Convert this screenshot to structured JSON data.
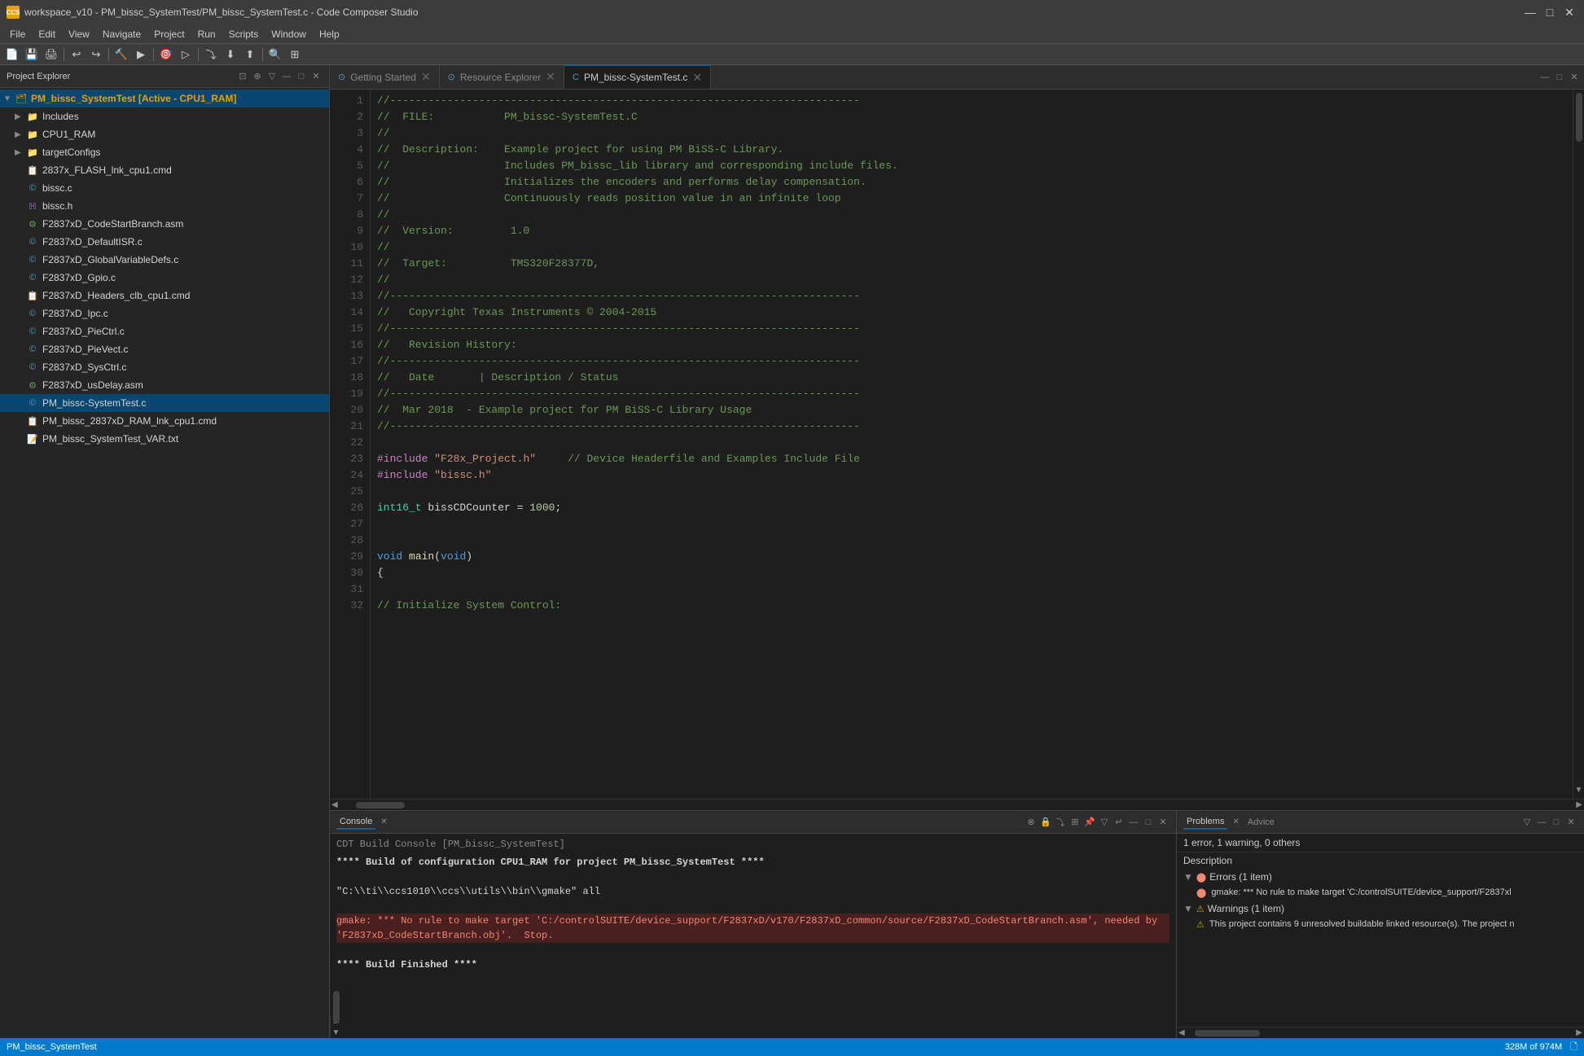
{
  "app": {
    "title": "workspace_v10 - PM_bissc_SystemTest/PM_bissc_SystemTest.c - Code Composer Studio",
    "icon_text": "CCS"
  },
  "window_controls": {
    "minimize": "—",
    "maximize": "□",
    "close": "✕"
  },
  "menu": {
    "items": [
      "File",
      "Edit",
      "View",
      "Navigate",
      "Project",
      "Run",
      "Scripts",
      "Window",
      "Help"
    ]
  },
  "project_explorer": {
    "title": "Project Explorer",
    "root": {
      "name": "PM_bissc_SystemTest  [Active - CPU1_RAM]",
      "children": [
        {
          "name": "Includes",
          "type": "folder",
          "indent": 1
        },
        {
          "name": "CPU1_RAM",
          "type": "folder",
          "indent": 1
        },
        {
          "name": "targetConfigs",
          "type": "folder",
          "indent": 1
        },
        {
          "name": "2837x_FLASH_lnk_cpu1.cmd",
          "type": "cmd",
          "indent": 1
        },
        {
          "name": "bissc.c",
          "type": "c",
          "indent": 1
        },
        {
          "name": "bissc.h",
          "type": "h",
          "indent": 1
        },
        {
          "name": "F2837xD_CodeStartBranch.asm",
          "type": "asm",
          "indent": 1
        },
        {
          "name": "F2837xD_DefaultISR.c",
          "type": "c",
          "indent": 1
        },
        {
          "name": "F2837xD_GlobalVariableDefs.c",
          "type": "c",
          "indent": 1
        },
        {
          "name": "F2837xD_Gpio.c",
          "type": "c",
          "indent": 1
        },
        {
          "name": "F2837xD_Headers_clb_cpu1.cmd",
          "type": "cmd",
          "indent": 1
        },
        {
          "name": "F2837xD_Ipc.c",
          "type": "c",
          "indent": 1
        },
        {
          "name": "F2837xD_PieCtrl.c",
          "type": "c",
          "indent": 1
        },
        {
          "name": "F2837xD_PieVect.c",
          "type": "c",
          "indent": 1
        },
        {
          "name": "F2837xD_SysCtrl.c",
          "type": "c",
          "indent": 1
        },
        {
          "name": "F2837xD_usDelay.asm",
          "type": "asm",
          "indent": 1
        },
        {
          "name": "PM_bissc-SystemTest.c",
          "type": "c",
          "indent": 1,
          "selected": true
        },
        {
          "name": "PM_bissc_2837xD_RAM_lnk_cpu1.cmd",
          "type": "cmd",
          "indent": 1
        },
        {
          "name": "PM_bissc_SystemTest_VAR.txt",
          "type": "txt",
          "indent": 1
        }
      ]
    }
  },
  "tabs": [
    {
      "label": "Getting Started",
      "icon": "⊙",
      "active": false
    },
    {
      "label": "Resource Explorer",
      "icon": "⊙",
      "active": false
    },
    {
      "label": "PM_bissc-SystemTest.c",
      "icon": "📄",
      "active": true
    }
  ],
  "code": {
    "lines": [
      {
        "num": 1,
        "text": "//--------------------------------------------------------------------------",
        "class": "c-comment"
      },
      {
        "num": 2,
        "text": "//  FILE:           PM_bissc-SystemTest.C",
        "class": "c-comment"
      },
      {
        "num": 3,
        "text": "//",
        "class": "c-comment"
      },
      {
        "num": 4,
        "text": "//  Description:    Example project for using PM BiSS-C Library.",
        "class": "c-comment"
      },
      {
        "num": 5,
        "text": "//                  Includes PM_bissc_lib library and corresponding include files.",
        "class": "c-comment"
      },
      {
        "num": 6,
        "text": "//                  Initializes the encoders and performs delay compensation.",
        "class": "c-comment"
      },
      {
        "num": 7,
        "text": "//                  Continuously reads position value in an infinite loop",
        "class": "c-comment"
      },
      {
        "num": 8,
        "text": "//",
        "class": "c-comment"
      },
      {
        "num": 9,
        "text": "//  Version:         1.0",
        "class": "c-comment"
      },
      {
        "num": 10,
        "text": "//",
        "class": "c-comment"
      },
      {
        "num": 11,
        "text": "//  Target:          TMS320F28377D,",
        "class": "c-comment"
      },
      {
        "num": 12,
        "text": "//",
        "class": "c-comment"
      },
      {
        "num": 13,
        "text": "//--------------------------------------------------------------------------",
        "class": "c-comment"
      },
      {
        "num": 14,
        "text": "//   Copyright Texas Instruments © 2004-2015",
        "class": "c-comment"
      },
      {
        "num": 15,
        "text": "//--------------------------------------------------------------------------",
        "class": "c-comment"
      },
      {
        "num": 16,
        "text": "//   Revision History:",
        "class": "c-comment"
      },
      {
        "num": 17,
        "text": "//--------------------------------------------------------------------------",
        "class": "c-comment"
      },
      {
        "num": 18,
        "text": "//   Date       | Description / Status",
        "class": "c-comment"
      },
      {
        "num": 19,
        "text": "//--------------------------------------------------------------------------",
        "class": "c-comment"
      },
      {
        "num": 20,
        "text": "//  Mar 2018  - Example project for PM BiSS-C Library Usage",
        "class": "c-comment"
      },
      {
        "num": 21,
        "text": "//--------------------------------------------------------------------------",
        "class": "c-comment"
      },
      {
        "num": 22,
        "text": "",
        "class": ""
      },
      {
        "num": 23,
        "text": "#include \"F28x_Project.h\"     // Device Headerfile and Examples Include File",
        "class": "mixed"
      },
      {
        "num": 24,
        "text": "#include \"bissc.h\"",
        "class": "mixed"
      },
      {
        "num": 25,
        "text": "",
        "class": ""
      },
      {
        "num": 26,
        "text": "int16_t bissCDCounter = 1000;",
        "class": "code"
      },
      {
        "num": 27,
        "text": "",
        "class": ""
      },
      {
        "num": 28,
        "text": "",
        "class": ""
      },
      {
        "num": 29,
        "text": "void main(void)",
        "class": "code"
      },
      {
        "num": 30,
        "text": "{",
        "class": "code"
      },
      {
        "num": 31,
        "text": "",
        "class": ""
      },
      {
        "num": 32,
        "text": "// Initialize System Control:",
        "class": "c-comment"
      }
    ]
  },
  "console": {
    "tab_label": "Console",
    "console_title": "CDT Build Console [PM_bissc_SystemTest]",
    "lines": [
      {
        "text": "**** Build of configuration CPU1_RAM for project PM_bissc_SystemTest ****",
        "bold": true,
        "error": false
      },
      {
        "text": "",
        "bold": false,
        "error": false
      },
      {
        "text": "\"C:\\\\ti\\\\ccs1010\\\\ccs\\\\utils\\\\bin\\\\gmake\" all",
        "bold": false,
        "error": false
      },
      {
        "text": "",
        "bold": false,
        "error": false
      },
      {
        "text": "gmake: *** No rule to make target 'C:/controlSUITE/device_support/F2837xD/v170/F2837xD_common/source/F2837xD_CodeStartBranch.asm', needed by 'F2837xD_CodeStartBranch.obj'.  Stop.",
        "bold": false,
        "error": true
      },
      {
        "text": "",
        "bold": false,
        "error": false
      },
      {
        "text": "**** Build Finished ****",
        "bold": true,
        "error": false
      }
    ]
  },
  "problems": {
    "tab_label": "Problems",
    "advice_tab": "Advice",
    "summary": "1 error, 1 warning, 0 others",
    "description_header": "Description",
    "sections": [
      {
        "label": "Errors (1 item)",
        "icon": "error",
        "items": [
          {
            "text": "gmake: *** No rule to make target 'C:/controlSUITE/device_support/F2837xl",
            "icon": "error"
          }
        ]
      },
      {
        "label": "Warnings (1 item)",
        "icon": "warning",
        "items": [
          {
            "text": "This project contains 9 unresolved buildable linked resource(s). The project n",
            "icon": "warning"
          }
        ]
      }
    ]
  },
  "status_bar": {
    "project": "PM_bissc_SystemTest",
    "memory": "328M of 974M",
    "memory_icon": "🗋"
  }
}
